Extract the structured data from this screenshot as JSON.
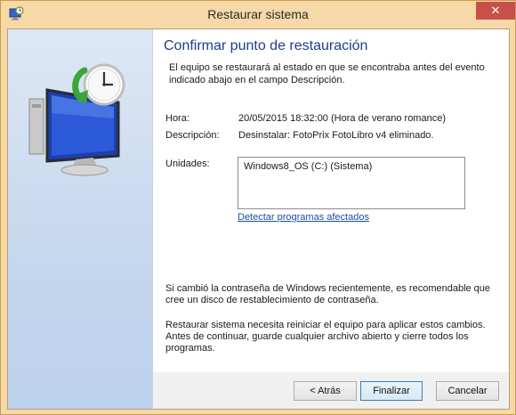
{
  "window": {
    "title": "Restaurar sistema",
    "close_glyph": "✕",
    "app_icon": "system-restore-icon"
  },
  "content": {
    "heading": "Confirmar punto de restauración",
    "intro": "El equipo se restaurará al estado en que se encontraba antes del evento indicado abajo en el campo Descripción.",
    "time_label": "Hora:",
    "time_value": "20/05/2015 18:32:00 (Hora de verano romance)",
    "description_label": "Descripción:",
    "description_value": "Desinstalar: FotoPrix FotoLibro v4 eliminado.",
    "drives_label": "Unidades:",
    "drives": [
      "Windows8_OS (C:) (Sistema)"
    ],
    "detect_link": "Detectar programas afectados",
    "note_password": "Si cambió la contraseña de Windows recientemente, es recomendable que cree un disco de restablecimiento de contraseña.",
    "note_restart": "Restaurar sistema necesita reiniciar el equipo para aplicar estos cambios. Antes de continuar, guarde cualquier archivo abierto y cierre todos los programas."
  },
  "buttons": {
    "back": "< Atrás",
    "finish": "Finalizar",
    "cancel": "Cancelar"
  },
  "colors": {
    "title_frame": "#f6d9a6",
    "heading": "#1e3c8c",
    "link": "#1a4fa0",
    "close": "#c7504a"
  }
}
